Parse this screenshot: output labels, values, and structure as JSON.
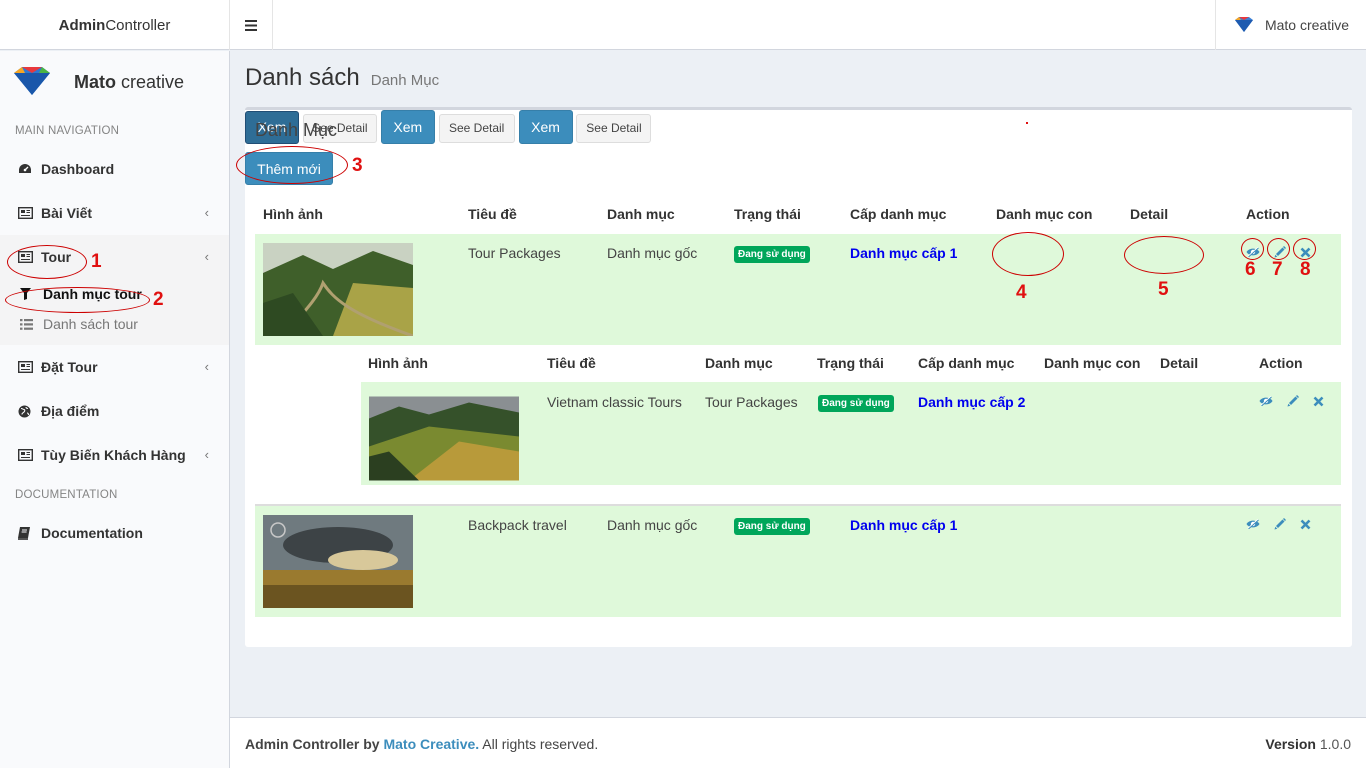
{
  "header": {
    "brand_bold": "Admin",
    "brand_rest": "Controller",
    "toggle_icon": "hamburger-icon",
    "user_name": "Mato creative"
  },
  "sidebar": {
    "logo_bold": "Mato",
    "logo_rest": " creative",
    "main_nav_header": "MAIN NAVIGATION",
    "items": [
      {
        "label": "Dashboard",
        "icon": "dashboard-icon"
      },
      {
        "label": "Bài Viết",
        "icon": "newspaper-icon"
      },
      {
        "label": "Tour",
        "icon": "newspaper-icon"
      },
      {
        "label": "Đặt Tour",
        "icon": "newspaper-icon"
      },
      {
        "label": "Địa điểm",
        "icon": "globe-icon"
      },
      {
        "label": "Tùy Biến Khách Hàng",
        "icon": "newspaper-icon"
      }
    ],
    "tour_sub": [
      {
        "label": "Danh mục tour",
        "icon": "filter-icon"
      },
      {
        "label": "Danh sách tour",
        "icon": "list-icon"
      }
    ],
    "doc_header": "DOCUMENTATION",
    "doc_item": "Documentation"
  },
  "page": {
    "title": "Danh sách",
    "subtitle": "Danh Mục"
  },
  "box": {
    "title": "Danh Mục",
    "add_button": "Thêm mới",
    "columns": [
      "Hình ảnh",
      "Tiêu đề",
      "Danh mục",
      "Trạng thái",
      "Cấp danh mục",
      "Danh mục con",
      "Detail",
      "Action"
    ],
    "rows": [
      {
        "title": "Tour Packages",
        "category": "Danh mục gốc",
        "status": "Đang sử dụng",
        "level": "Danh mục cấp 1",
        "view": "Xem",
        "detail": "See Detail"
      },
      {
        "title": "Backpack travel",
        "category": "Danh mục gốc",
        "status": "Đang sử dụng",
        "level": "Danh mục cấp 1",
        "view": "Xem",
        "detail": "See Detail"
      }
    ],
    "sub_columns": [
      "Hình ảnh",
      "Tiêu đề",
      "Danh mục",
      "Trạng thái",
      "Cấp danh mục",
      "Danh mục con",
      "Detail",
      "Action"
    ],
    "sub_rows": [
      {
        "title": "Vietnam classic Tours",
        "category": "Tour Packages",
        "status": "Đang sử dụng",
        "level": "Danh mục cấp 2",
        "view": "Xem",
        "detail": "See Detail"
      }
    ]
  },
  "annotations": [
    "1",
    "2",
    "3",
    "4",
    "5",
    "6",
    "7",
    "8"
  ],
  "footer": {
    "prefix": "Admin Controller by ",
    "brand": "Mato Creative.",
    "suffix": " All rights reserved.",
    "version_label": "Version",
    "version": " 1.0.0"
  },
  "colors": {
    "primary": "#3c8dbc",
    "status_green": "#00a65a",
    "row_highlight": "#dff9da",
    "level_link": "#0000ee",
    "annotation_red": "#e01010"
  }
}
